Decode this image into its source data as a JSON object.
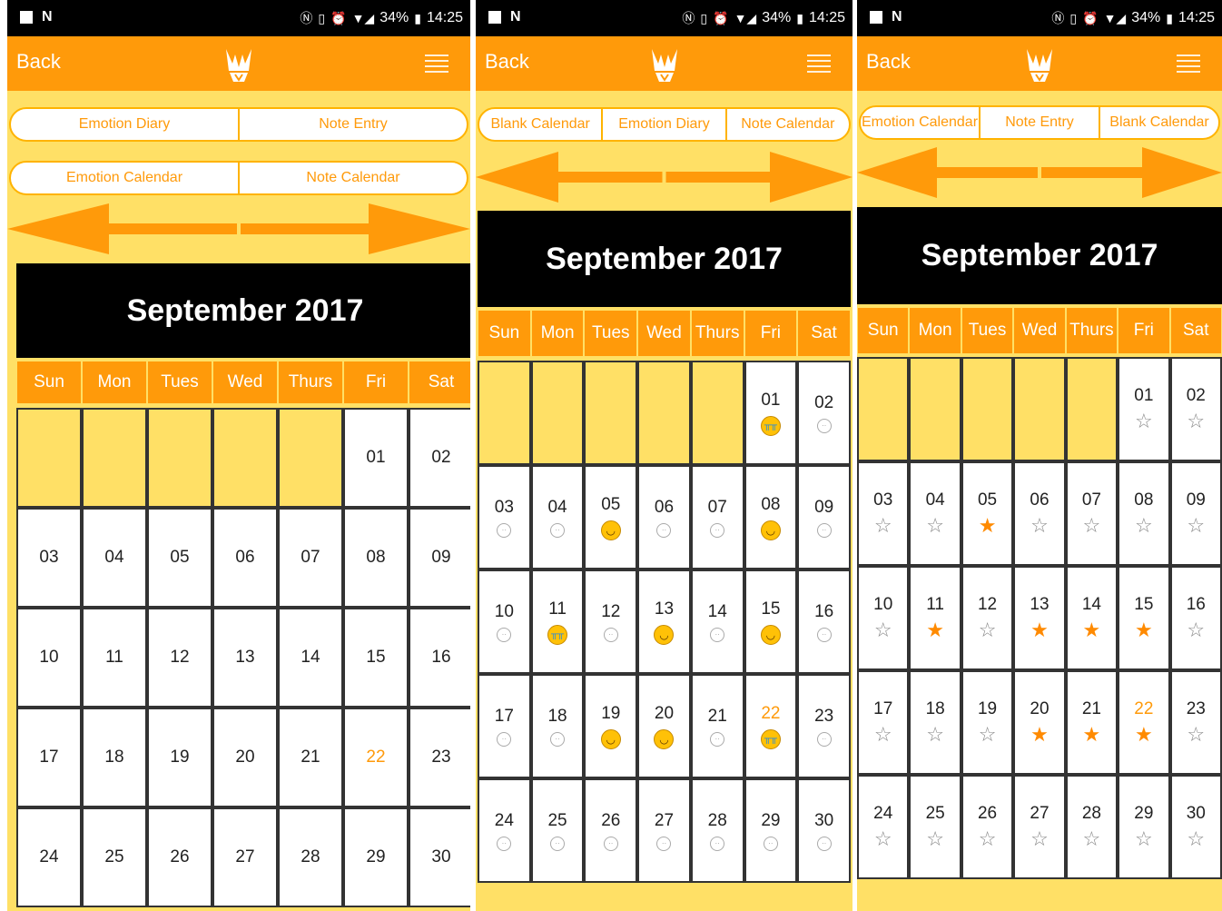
{
  "status": {
    "signal": "▼◢",
    "battery": "34%",
    "time": "14:25"
  },
  "screens": [
    {
      "back_label": "Back",
      "row1": [
        "Emotion Diary",
        "Note Entry"
      ],
      "row2": [
        "Emotion Calendar",
        "Note Calendar"
      ],
      "month": "September 2017",
      "weekdays": [
        "Sun",
        "Mon",
        "Tues",
        "Wed",
        "Thurs",
        "Fri",
        "Sat"
      ],
      "lead_empty": 5,
      "days": [
        "01",
        "02",
        "03",
        "04",
        "05",
        "06",
        "07",
        "08",
        "09",
        "10",
        "11",
        "12",
        "13",
        "14",
        "15",
        "16",
        "17",
        "18",
        "19",
        "20",
        "21",
        "22",
        "23",
        "24",
        "25",
        "26",
        "27",
        "28",
        "29",
        "30"
      ],
      "marks": [],
      "today": "22"
    },
    {
      "back_label": "Back",
      "row1": [
        "Blank Calendar",
        "Emotion Diary",
        "Note Calendar"
      ],
      "month": "September 2017",
      "weekdays": [
        "Sun",
        "Mon",
        "Tues",
        "Wed",
        "Thurs",
        "Fri",
        "Sat"
      ],
      "lead_empty": 5,
      "days": [
        "01",
        "02",
        "03",
        "04",
        "05",
        "06",
        "07",
        "08",
        "09",
        "10",
        "11",
        "12",
        "13",
        "14",
        "15",
        "16",
        "17",
        "18",
        "19",
        "20",
        "21",
        "22",
        "23",
        "24",
        "25",
        "26",
        "27",
        "28",
        "29",
        "30"
      ],
      "marks": [
        "cry",
        "neutral",
        "neutral",
        "neutral",
        "happy",
        "neutral",
        "neutral",
        "happy",
        "neutral",
        "neutral",
        "cry",
        "neutral",
        "happy",
        "neutral",
        "happy",
        "neutral",
        "neutral",
        "neutral",
        "happy",
        "happy",
        "neutral",
        "cry",
        "neutral",
        "neutral",
        "neutral",
        "neutral",
        "neutral",
        "neutral",
        "neutral",
        "neutral"
      ],
      "today": "22"
    },
    {
      "back_label": "Back",
      "row1": [
        "Emotion Calendar",
        "Note Entry",
        "Blank Calendar"
      ],
      "month": "September 2017",
      "weekdays": [
        "Sun",
        "Mon",
        "Tues",
        "Wed",
        "Thurs",
        "Fri",
        "Sat"
      ],
      "lead_empty": 5,
      "days": [
        "01",
        "02",
        "03",
        "04",
        "05",
        "06",
        "07",
        "08",
        "09",
        "10",
        "11",
        "12",
        "13",
        "14",
        "15",
        "16",
        "17",
        "18",
        "19",
        "20",
        "21",
        "22",
        "23",
        "24",
        "25",
        "26",
        "27",
        "28",
        "29",
        "30"
      ],
      "marks": [
        "star-empty",
        "star-empty",
        "star-empty",
        "star-empty",
        "star-full",
        "star-empty",
        "star-empty",
        "star-empty",
        "star-empty",
        "star-empty",
        "star-full",
        "star-empty",
        "star-full",
        "star-full",
        "star-full",
        "star-empty",
        "star-empty",
        "star-empty",
        "star-empty",
        "star-full",
        "star-full",
        "star-full",
        "star-empty",
        "star-empty",
        "star-empty",
        "star-empty",
        "star-empty",
        "star-empty",
        "star-empty",
        "star-empty"
      ],
      "today": "22"
    }
  ],
  "colors": {
    "accent": "#FF9A0A",
    "bg": "#FFE066",
    "header": "#000000"
  }
}
